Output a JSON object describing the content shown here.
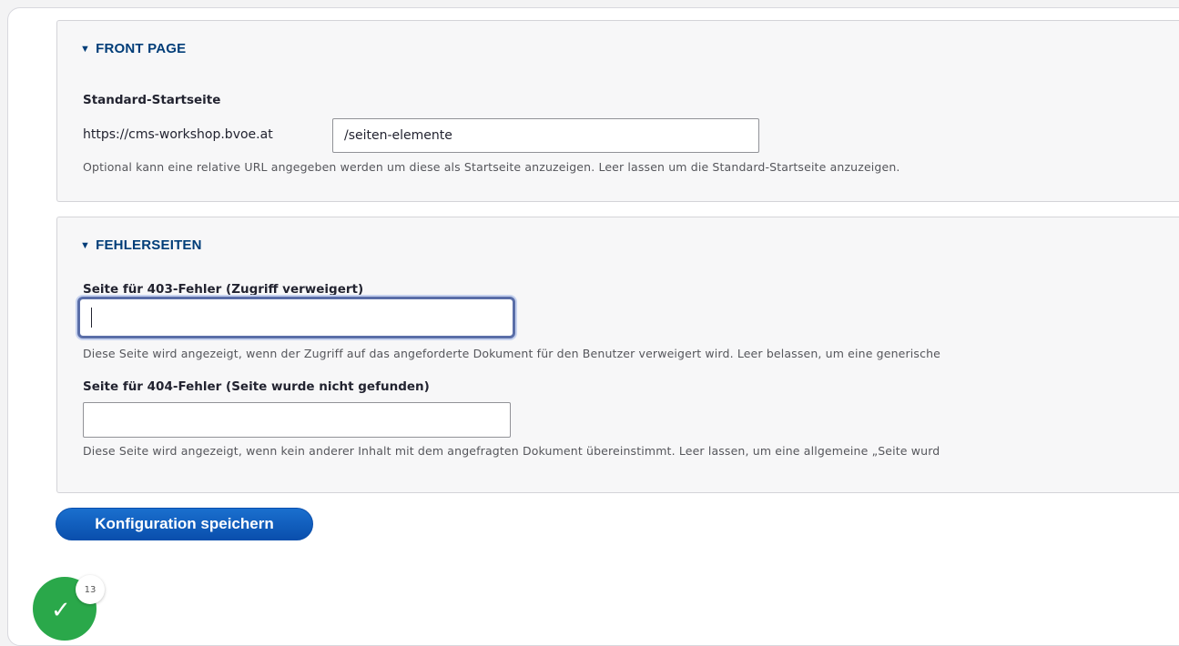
{
  "front_page": {
    "summary": "FRONT PAGE",
    "label": "Standard-Startseite",
    "prefix": "https://cms-workshop.bvoe.at",
    "value": "/seiten-elemente",
    "description": "Optional kann eine relative URL angegeben werden um diese als Startseite anzuzeigen. Leer lassen um die Standard-Startseite anzuzeigen."
  },
  "error_pages": {
    "summary": "FEHLERSEITEN",
    "field_403": {
      "label": "Seite für 403-Fehler (Zugriff verweigert)",
      "value": "",
      "description": "Diese Seite wird angezeigt, wenn der Zugriff auf das angeforderte Dokument für den Benutzer verweigert wird. Leer belassen, um eine generische"
    },
    "field_404": {
      "label": "Seite für 404-Fehler (Seite wurde nicht gefunden)",
      "value": "",
      "description": "Diese Seite wird angezeigt, wenn kein anderer Inhalt mit dem angefragten Dokument übereinstimmt. Leer lassen, um eine allgemeine „Seite wurd"
    }
  },
  "actions": {
    "save_label": "Konfiguration speichern"
  },
  "progress_badge": {
    "icon": "check-icon",
    "count": "13",
    "color": "#2aa84a"
  },
  "colors": {
    "accent": "#003d78",
    "button": "#0a4fad",
    "focus": "#5a6ea8"
  }
}
